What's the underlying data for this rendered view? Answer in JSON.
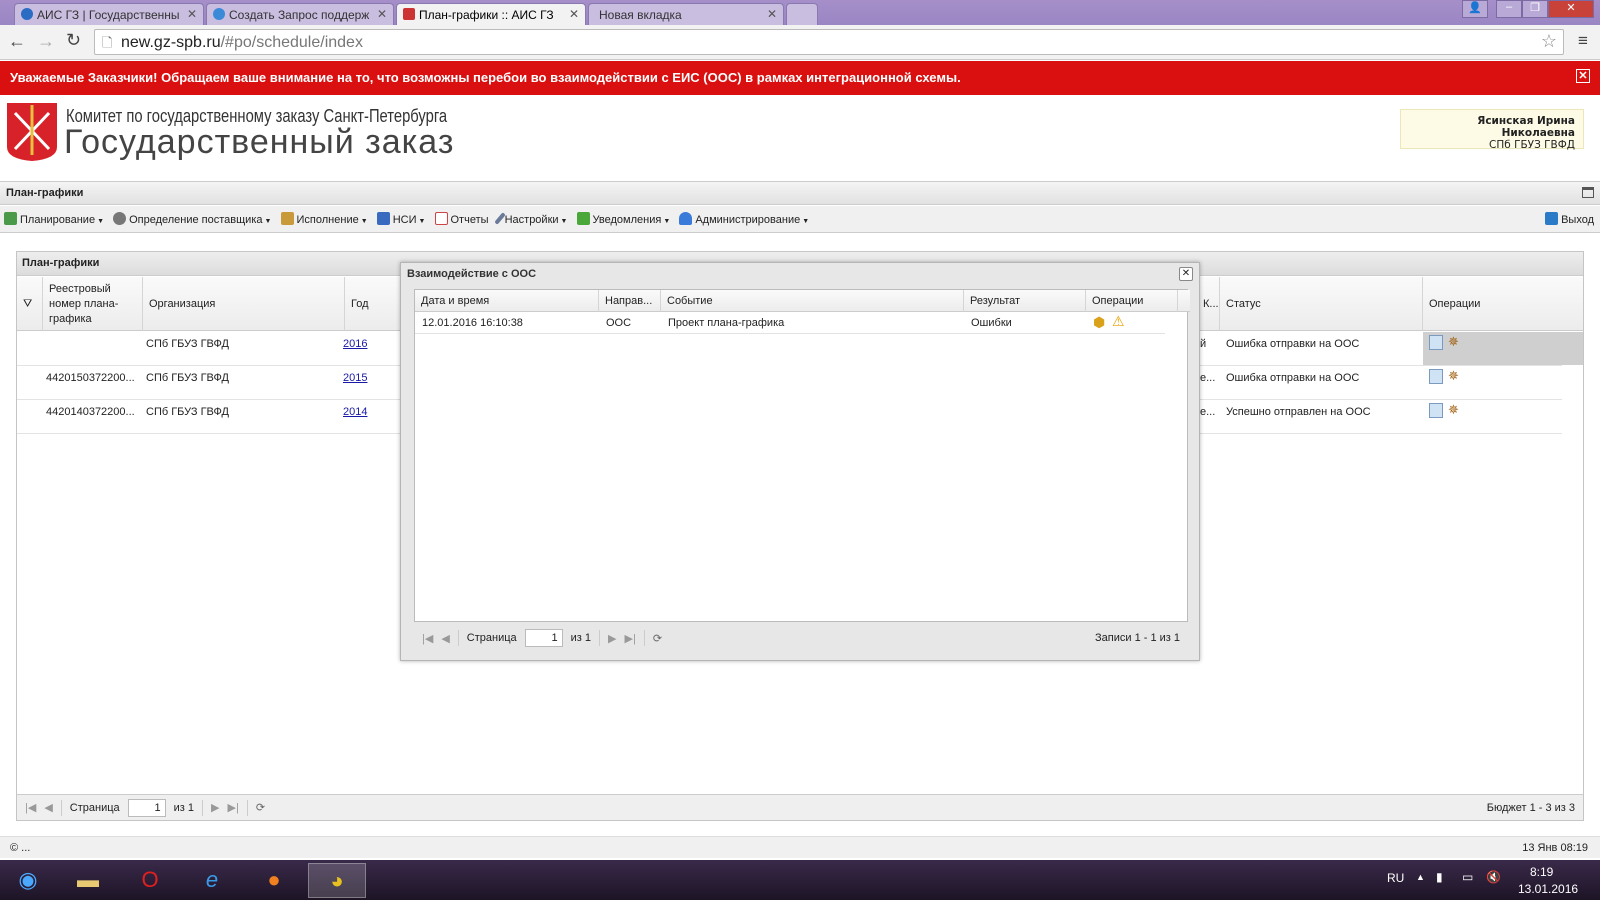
{
  "browser": {
    "tabs": [
      {
        "label": "АИС ГЗ | Государственны"
      },
      {
        "label": "Создать Запрос поддерж"
      },
      {
        "label": "План-графики :: АИС ГЗ"
      },
      {
        "label": "Новая вкладка"
      }
    ],
    "url_host": "new.gz-spb.ru",
    "url_path": "/#po/schedule/index"
  },
  "banner": {
    "text": "Уважаемые Заказчики! Обращаем ваше внимание на то, что возможны перебои во взаимодействии с ЕИС (ООС) в рамках интеграционной схемы."
  },
  "header": {
    "subtitle": "Комитет по государственному заказу Санкт-Петербурга",
    "title": "Государственный заказ",
    "user_name": "Ясинская Ирина Николаевна",
    "user_org": "СПб ГБУЗ ГВФД"
  },
  "section_title": "План-графики",
  "toolbar": {
    "items": [
      "Планирование",
      "Определение поставщика",
      "Исполнение",
      "НСИ",
      "Отчеты",
      "Настройки",
      "Уведомления",
      "Администрирование"
    ],
    "exit": "Выход"
  },
  "panel": {
    "title": "План-графики",
    "columns": [
      "Реестровый номер плана-графика",
      "Организация",
      "Год",
      "К...",
      "Статус",
      "Операции"
    ],
    "rows": [
      {
        "reg": "",
        "org": "СПб ГБУЗ ГВФД",
        "year": "2016",
        "col4": "й",
        "status": "Ошибка отправки на ООС"
      },
      {
        "reg": "4420150372200...",
        "org": "СПб ГБУЗ ГВФД",
        "year": "2015",
        "col4": "е...",
        "status": "Ошибка отправки на ООС"
      },
      {
        "reg": "4420140372200...",
        "org": "СПб ГБУЗ ГВФД",
        "year": "2014",
        "col4": "е...",
        "status": "Успешно отправлен на ООС"
      }
    ],
    "pager": {
      "page_label": "Страница",
      "page": "1",
      "of": "из 1",
      "summary": "Бюджет 1 - 3 из 3"
    }
  },
  "dialog": {
    "title": "Взаимодействие с ООС",
    "columns": [
      "Дата и время",
      "Направ...",
      "Событие",
      "Результат",
      "Операции"
    ],
    "rows": [
      {
        "date": "12.01.2016 16:10:38",
        "direction": "ООС",
        "event": "Проект плана-графика",
        "result": "Ошибки"
      }
    ],
    "pager": {
      "page_label": "Страница",
      "page": "1",
      "of": "из 1",
      "summary": "Записи 1 - 1 из 1"
    }
  },
  "statusbar": {
    "left": "© ...",
    "right": "13 Янв 08:19"
  },
  "taskbar": {
    "lang": "RU",
    "time": "8:19",
    "date": "13.01.2016"
  }
}
